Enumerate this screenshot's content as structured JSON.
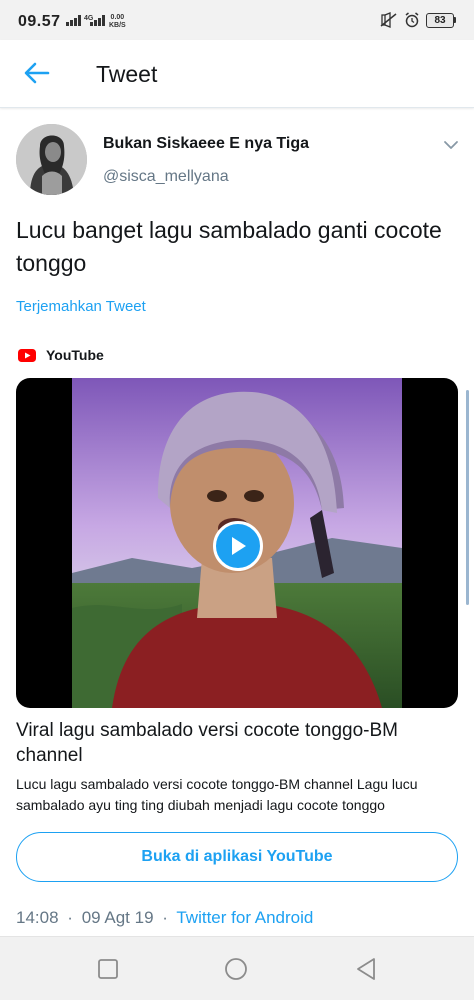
{
  "status_bar": {
    "time": "09.57",
    "network": "4G",
    "speed_value": "0.00",
    "speed_unit": "KB/S",
    "battery": "83",
    "icons": [
      "signal-icon",
      "signal-icon",
      "mute-icon",
      "alarm-icon",
      "battery-icon"
    ]
  },
  "header": {
    "title": "Tweet",
    "back_icon": "arrow-left-icon"
  },
  "tweet": {
    "display_name": "Bukan Siskaeee E nya Tiga",
    "handle": "@sisca_mellyana",
    "text": "Lucu banget lagu sambalado ganti cocote tonggo",
    "translate_label": "Terjemahkan Tweet",
    "time": "14:08",
    "date": "09 Agt 19",
    "separator": "·",
    "client": "Twitter for Android"
  },
  "card": {
    "source": "YouTube",
    "title": "Viral lagu sambalado versi cocote tonggo-BM channel",
    "description": "Lucu lagu sambalado versi cocote tonggo-BM channel Lagu lucu sambalado ayu ting ting diubah menjadi lagu cocote tonggo",
    "button_label": "Buka di aplikasi YouTube"
  },
  "colors": {
    "accent": "#1da1f2",
    "text": "#14171a",
    "secondary": "#657786",
    "youtube_red": "#ff0000"
  }
}
